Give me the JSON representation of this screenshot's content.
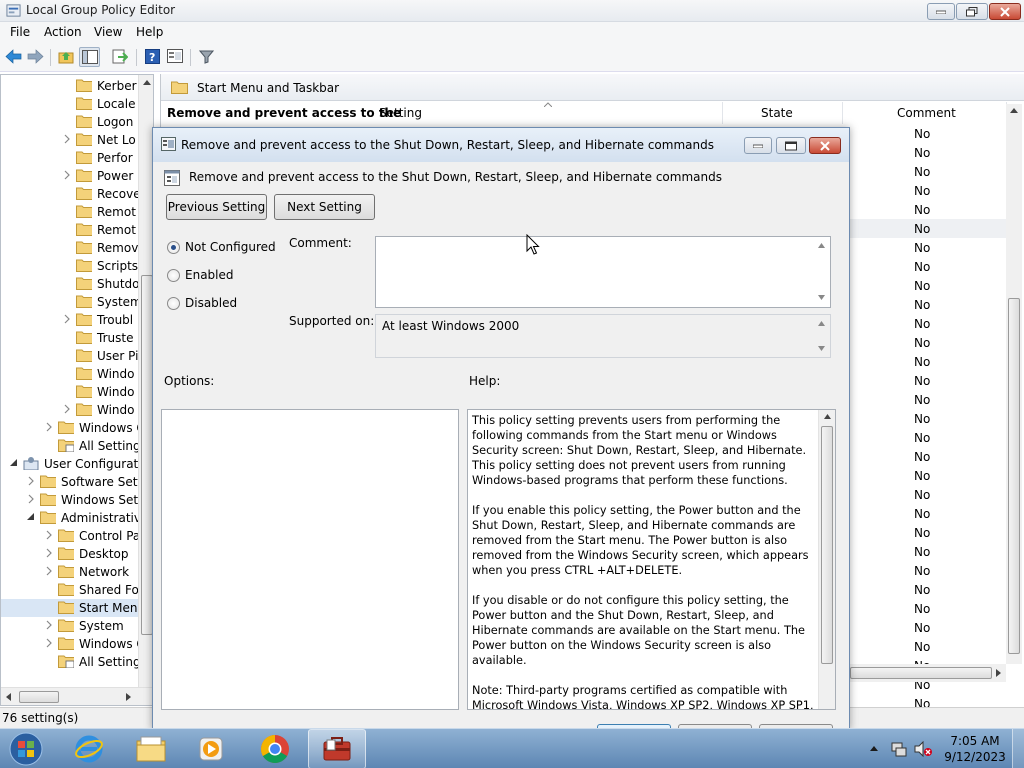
{
  "window": {
    "title": "Local Group Policy Editor"
  },
  "menu": [
    "File",
    "Action",
    "View",
    "Help"
  ],
  "tree": [
    {
      "label": "Kerber",
      "indent": 3,
      "arrow": "none"
    },
    {
      "label": "Locale",
      "indent": 3,
      "arrow": "none"
    },
    {
      "label": "Logon",
      "indent": 3,
      "arrow": "none"
    },
    {
      "label": "Net Lo",
      "indent": 3,
      "arrow": "right"
    },
    {
      "label": "Perfor",
      "indent": 3,
      "arrow": "none"
    },
    {
      "label": "Power",
      "indent": 3,
      "arrow": "right"
    },
    {
      "label": "Recove",
      "indent": 3,
      "arrow": "none"
    },
    {
      "label": "Remot",
      "indent": 3,
      "arrow": "none"
    },
    {
      "label": "Remot",
      "indent": 3,
      "arrow": "none"
    },
    {
      "label": "Remov",
      "indent": 3,
      "arrow": "none"
    },
    {
      "label": "Scripts",
      "indent": 3,
      "arrow": "none"
    },
    {
      "label": "Shutdo",
      "indent": 3,
      "arrow": "none"
    },
    {
      "label": "System",
      "indent": 3,
      "arrow": "none"
    },
    {
      "label": "Troubl",
      "indent": 3,
      "arrow": "right"
    },
    {
      "label": "Truste",
      "indent": 3,
      "arrow": "none"
    },
    {
      "label": "User Pi",
      "indent": 3,
      "arrow": "none"
    },
    {
      "label": "Windo",
      "indent": 3,
      "arrow": "none"
    },
    {
      "label": "Windo",
      "indent": 3,
      "arrow": "none"
    },
    {
      "label": "Windo",
      "indent": 3,
      "arrow": "right"
    },
    {
      "label": "Windows C",
      "indent": 2,
      "arrow": "right"
    },
    {
      "label": "All Setting",
      "indent": 2,
      "arrow": "none",
      "icon": "settings"
    },
    {
      "label": "User Configuratio",
      "indent": 0,
      "arrow": "down",
      "icon": "user"
    },
    {
      "label": "Software Setti",
      "indent": 1,
      "arrow": "right"
    },
    {
      "label": "Windows Sett",
      "indent": 1,
      "arrow": "right"
    },
    {
      "label": "Administrative",
      "indent": 1,
      "arrow": "down"
    },
    {
      "label": "Control Pa",
      "indent": 2,
      "arrow": "right"
    },
    {
      "label": "Desktop",
      "indent": 2,
      "arrow": "right"
    },
    {
      "label": "Network",
      "indent": 2,
      "arrow": "right"
    },
    {
      "label": "Shared Fol",
      "indent": 2,
      "arrow": "none"
    },
    {
      "label": "Start Menu",
      "indent": 2,
      "arrow": "none",
      "selected": true
    },
    {
      "label": "System",
      "indent": 2,
      "arrow": "right"
    },
    {
      "label": "Windows C",
      "indent": 2,
      "arrow": "right"
    },
    {
      "label": "All Setting",
      "indent": 2,
      "arrow": "none",
      "icon": "settings"
    }
  ],
  "right_pane": {
    "header": "Start Menu and Taskbar",
    "policy_title": "Remove and prevent access to the",
    "columns": {
      "setting": "Setting",
      "state": "State",
      "comment": "Comment"
    },
    "state_values": [
      "No",
      "No",
      "No",
      "No",
      "No",
      "No",
      "No",
      "No",
      "No",
      "No",
      "No",
      "No",
      "No",
      "No",
      "No",
      "No",
      "No",
      "No",
      "No",
      "No",
      "No",
      "No",
      "No",
      "No",
      "No",
      "No",
      "No",
      "No",
      "No",
      "No",
      "No",
      "No"
    ]
  },
  "status": {
    "text": "76 setting(s)"
  },
  "dialog": {
    "title": "Remove and prevent access to the Shut Down, Restart, Sleep, and Hibernate commands",
    "subtitle": "Remove and prevent access to the Shut Down, Restart, Sleep, and Hibernate commands",
    "prev_label": "Previous Setting",
    "next_label": "Next Setting",
    "radios": [
      {
        "label": "Not Configured",
        "checked": true
      },
      {
        "label": "Enabled",
        "checked": false
      },
      {
        "label": "Disabled",
        "checked": false
      }
    ],
    "comment_label": "Comment:",
    "supported_label": "Supported on:",
    "supported_value": "At least Windows 2000",
    "options_label": "Options:",
    "help_label": "Help:",
    "help_text": "This policy setting prevents users from performing the following commands from the Start menu or Windows Security screen: Shut Down, Restart, Sleep, and Hibernate. This policy setting does not prevent users from running Windows-based programs that perform these functions.\n\nIf you enable this policy setting, the Power button and the Shut Down, Restart, Sleep, and Hibernate commands are removed from the Start menu. The Power button is also removed from the Windows Security screen, which appears when you press CTRL +ALT+DELETE.\n\nIf you disable or do not configure this policy setting, the Power button and the Shut Down, Restart, Sleep, and Hibernate commands are available on the Start menu. The Power button on the Windows Security screen is also available.\n\nNote: Third-party programs certified as compatible with Microsoft Windows Vista, Windows XP SP2, Windows XP SP1,"
  },
  "taskbar": {
    "time": "7:05 AM",
    "date": "9/12/2023",
    "apps": [
      "windows-start-icon",
      "internet-explorer-icon",
      "file-explorer-icon",
      "media-player-icon",
      "chrome-icon",
      "group-policy-editor-icon"
    ]
  }
}
